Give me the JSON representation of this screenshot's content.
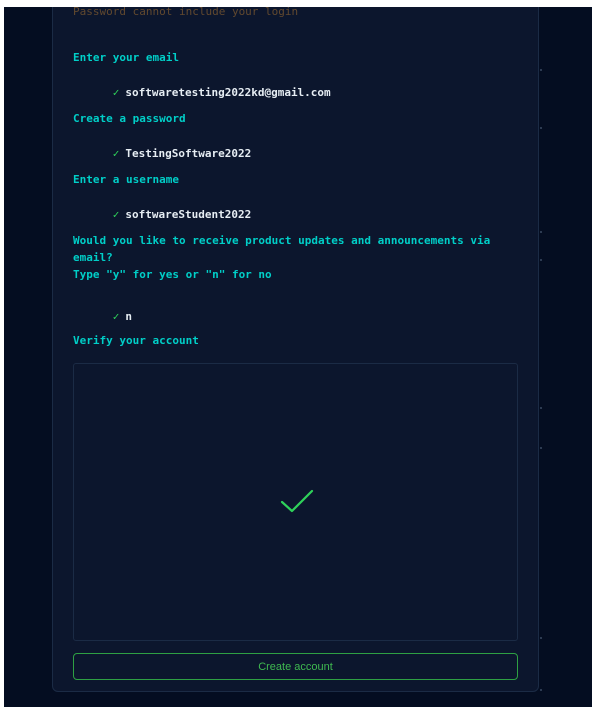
{
  "notice": "Password cannot include your login",
  "email": {
    "prompt": "Enter your email",
    "check": "✓",
    "value": "softwaretesting2022kd@gmail.com"
  },
  "password": {
    "prompt": "Create a password",
    "check": "✓",
    "value": "TestingSoftware2022"
  },
  "username": {
    "prompt": "Enter a username",
    "check": "✓",
    "value": "softwareStudent2022"
  },
  "updates": {
    "prompt_line1": "Would you like to receive product updates and announcements via",
    "prompt_line2": "email?",
    "prompt_line3": "Type \"y\" for yes or \"n\" for no",
    "check": "✓",
    "value": "n"
  },
  "verify": {
    "prompt": "Verify your account",
    "status_icon": "check-icon"
  },
  "create_button": {
    "label": "Create account"
  },
  "colors": {
    "background": "#040d21",
    "panel": "#0c162d",
    "prompt": "#00cfc8",
    "check": "#2fd25a",
    "button_border": "#2ea043"
  }
}
